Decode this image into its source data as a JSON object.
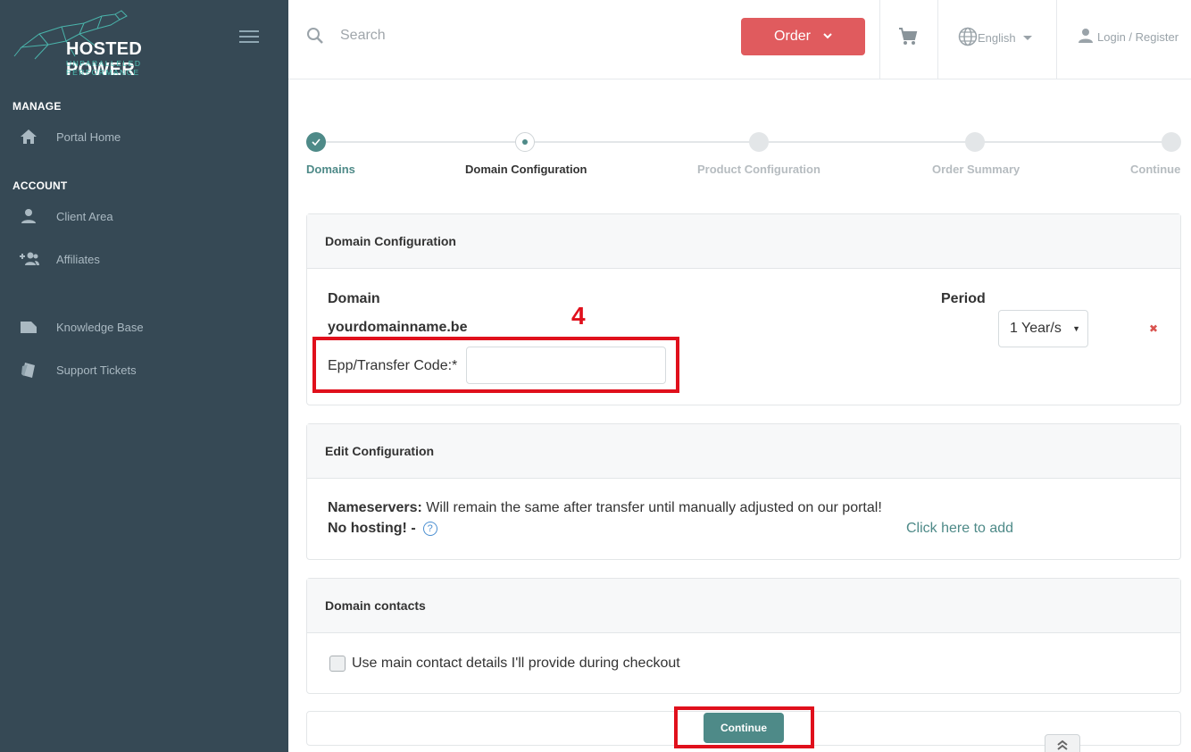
{
  "brand": {
    "name": "HOSTED POWER",
    "tagline": "UNPARALLELED PERFORMANCE",
    "accent": "#4dc0b5"
  },
  "sidebar": {
    "sections": [
      {
        "title": "MANAGE"
      },
      {
        "title": "ACCOUNT"
      }
    ],
    "items": [
      {
        "label": "Portal Home",
        "icon": "home-icon"
      },
      {
        "label": "Client Area",
        "icon": "person-icon"
      },
      {
        "label": "Affiliates",
        "icon": "add-person-icon"
      },
      {
        "label": "Knowledge Base",
        "icon": "folder-icon"
      },
      {
        "label": "Support Tickets",
        "icon": "ticket-icon"
      }
    ]
  },
  "topbar": {
    "search_placeholder": "Search",
    "order_label": "Order",
    "language": "English",
    "login": "Login / Register"
  },
  "steps": [
    {
      "label": "Domains",
      "state": "done"
    },
    {
      "label": "Domain Configuration",
      "state": "current"
    },
    {
      "label": "Product Configuration",
      "state": "pending"
    },
    {
      "label": "Order Summary",
      "state": "pending"
    },
    {
      "label": "Continue",
      "state": "pending"
    }
  ],
  "domain_config": {
    "title": "Domain Configuration",
    "domain_header": "Domain",
    "period_header": "Period",
    "domain_name": "yourdomainname.be",
    "period_value": "1 Year/s",
    "epp_label": "Epp/Transfer Code:*",
    "epp_value": "",
    "annotation": "4"
  },
  "edit_config": {
    "title": "Edit Configuration",
    "nameservers_label": "Nameservers:",
    "nameservers_text": " Will remain the same after transfer until manually adjusted on our portal!",
    "no_hosting_label": "No hosting! -",
    "add_link": "Click here to add"
  },
  "contacts": {
    "title": "Domain contacts",
    "checkbox_label": "Use main contact details I'll provide during checkout"
  },
  "continue_label": "Continue",
  "colors": {
    "sidebar_bg": "#364955",
    "order_button": "#e05b5e",
    "primary": "#4e8a88",
    "annotation": "#e0101c"
  }
}
